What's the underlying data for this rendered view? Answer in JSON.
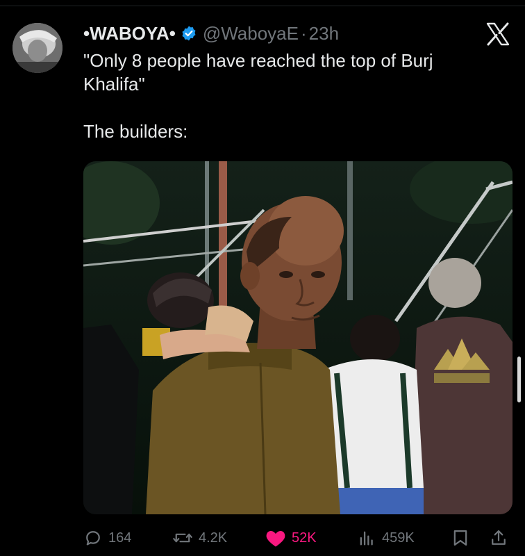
{
  "tweet": {
    "author": {
      "display_name": "•WABOYA•",
      "handle": "@WaboyaE",
      "verified": true,
      "avatar_icon": "profile-avatar"
    },
    "separator": "·",
    "time": "23h",
    "text": "\"Only 8 people have reached the top of Burj Khalifa\"\n\nThe builders:",
    "media_type": "photo",
    "stats": {
      "replies": "164",
      "reposts": "4.2K",
      "likes": "52K",
      "views": "459K"
    },
    "liked": true
  },
  "icons": {
    "brand": "x-logo-icon",
    "verified": "verified-badge-icon",
    "reply": "reply-icon",
    "repost": "repost-icon",
    "like": "heart-icon",
    "views": "views-icon",
    "bookmark": "bookmark-icon",
    "share": "share-icon"
  },
  "colors": {
    "background": "#000000",
    "text": "#e7e9ea",
    "muted": "#71767b",
    "verified": "#1d9bf0",
    "like": "#f91880"
  }
}
